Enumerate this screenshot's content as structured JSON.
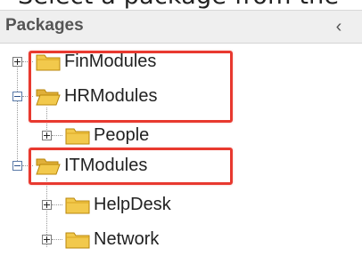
{
  "cut_heading": "Select a package from the",
  "panel": {
    "title": "Packages",
    "collapse_glyph": "‹"
  },
  "tree": {
    "nodes": [
      {
        "label": "FinModules",
        "expanded": false,
        "folder_state": "closed",
        "level": 0
      },
      {
        "label": "HRModules",
        "expanded": true,
        "folder_state": "open",
        "level": 0
      },
      {
        "label": "People",
        "expanded": false,
        "folder_state": "closed",
        "level": 1
      },
      {
        "label": "ITModules",
        "expanded": true,
        "folder_state": "open",
        "level": 0
      },
      {
        "label": "HelpDesk",
        "expanded": false,
        "folder_state": "closed",
        "level": 1
      },
      {
        "label": "Network",
        "expanded": false,
        "folder_state": "closed",
        "level": 1
      }
    ]
  },
  "icons": {
    "collapse": "chevron-left-icon",
    "expand": "plus-box-icon",
    "collapse_node": "minus-box-icon",
    "folder_closed": "folder-closed-icon",
    "folder_open": "folder-open-icon"
  },
  "colors": {
    "highlight": "#e8392f",
    "folder_fill": "#f2c94c",
    "folder_edge": "#b8860b",
    "header_bg": "#efefef"
  }
}
